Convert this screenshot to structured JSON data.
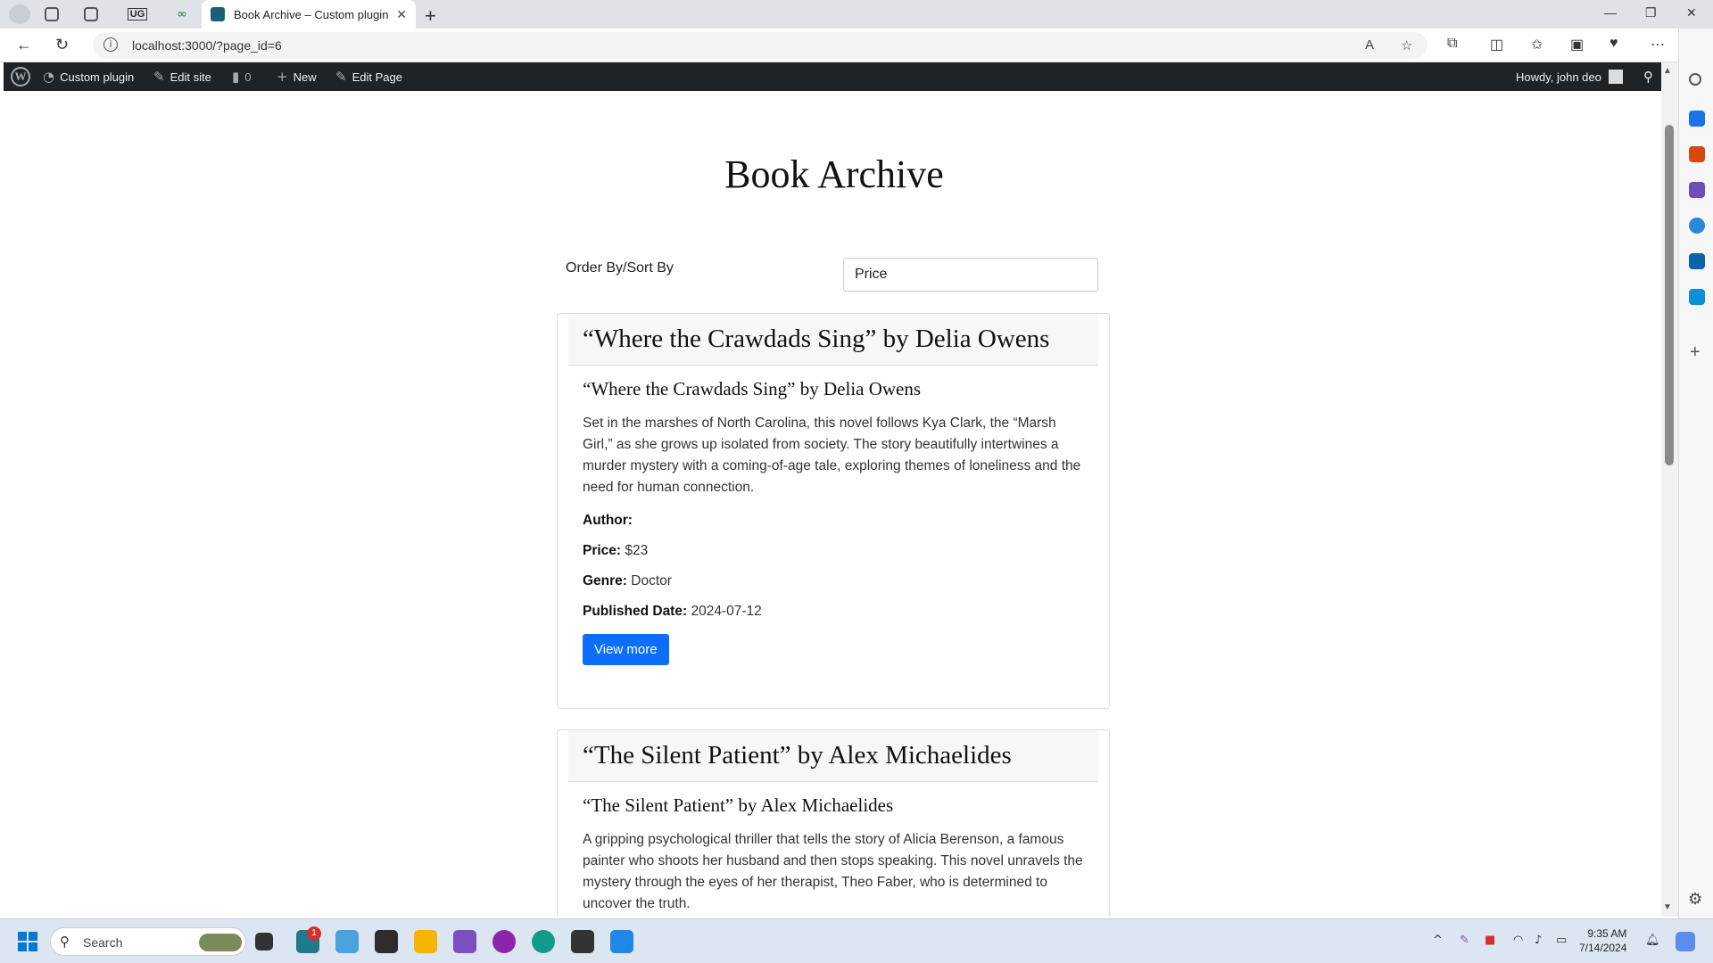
{
  "browser": {
    "active_tab_title": "Book Archive – Custom plugin",
    "pinned_tab_label": "UG",
    "url": "localhost:3000/?page_id=6"
  },
  "adminbar": {
    "site_name": "Custom plugin",
    "edit_site": "Edit site",
    "comments_count": "0",
    "new_label": "New",
    "edit_page": "Edit Page",
    "howdy": "Howdy, john deo"
  },
  "page": {
    "title": "Book Archive",
    "sort_label": "Order By/Sort By",
    "sort_value": "Price"
  },
  "books": [
    {
      "header": "“Where the Crawdads Sing” by Delia Owens",
      "title": "“Where the Crawdads Sing” by Delia Owens",
      "description": "Set in the marshes of North Carolina, this novel follows Kya Clark, the “Marsh Girl,” as she grows up isolated from society. The story beautifully intertwines a murder mystery with a coming-of-age tale, exploring themes of loneliness and the need for human connection.",
      "author_label": "Author:",
      "author": "",
      "price_label": "Price:",
      "price": "$23",
      "genre_label": "Genre:",
      "genre": "Doctor",
      "date_label": "Published Date:",
      "date": "2024-07-12",
      "button": "View more"
    },
    {
      "header": "“The Silent Patient” by Alex Michaelides",
      "title": "“The Silent Patient” by Alex Michaelides",
      "description": "A gripping psychological thriller that tells the story of Alicia Berenson, a famous painter who shoots her husband and then stops speaking. This novel unravels the mystery through the eyes of her therapist, Theo Faber, who is determined to uncover the truth."
    }
  ],
  "taskbar": {
    "search_placeholder": "Search",
    "time": "9:35 AM",
    "date": "7/14/2024",
    "notification_badge": "1"
  },
  "colors": {
    "adminbar_bg": "#1d2327",
    "primary_button": "#0d6efd"
  }
}
